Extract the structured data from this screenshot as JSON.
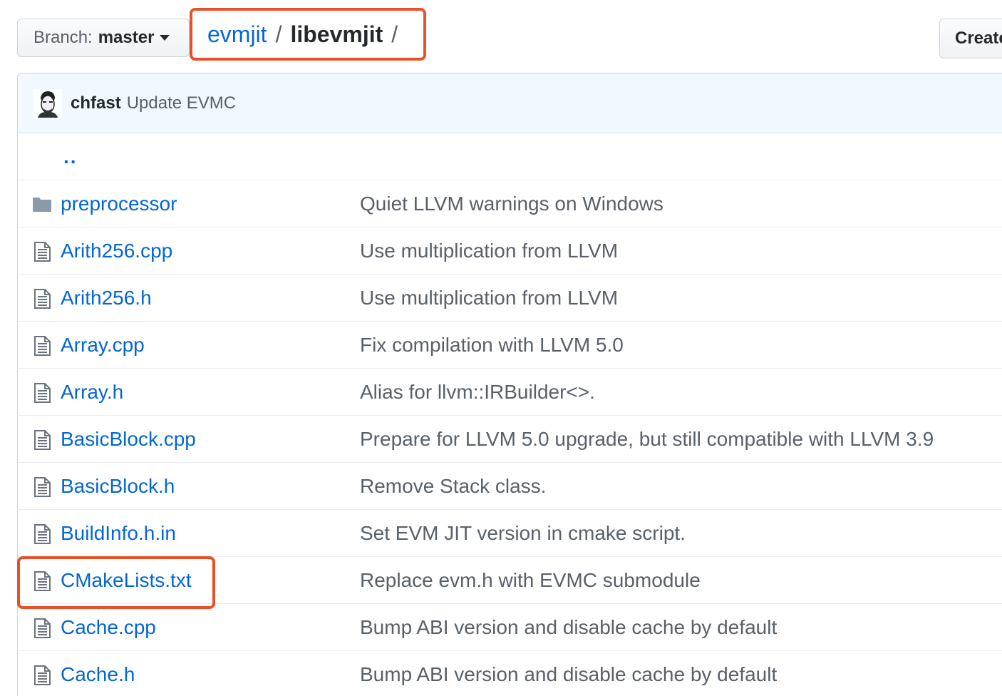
{
  "branch": {
    "prefix": "Branch:",
    "name": "master"
  },
  "breadcrumb": {
    "repo": "evmjit",
    "separator": "/",
    "current": "libevmjit",
    "trailing": "/"
  },
  "create_button": {
    "label": "Create"
  },
  "commit": {
    "author": "chfast",
    "message": "Update EVMC"
  },
  "up_dir": {
    "label": ".."
  },
  "files": [
    {
      "name": "preprocessor",
      "type": "folder",
      "message": "Quiet LLVM warnings on Windows"
    },
    {
      "name": "Arith256.cpp",
      "type": "file",
      "message": "Use multiplication from LLVM"
    },
    {
      "name": "Arith256.h",
      "type": "file",
      "message": "Use multiplication from LLVM"
    },
    {
      "name": "Array.cpp",
      "type": "file",
      "message": "Fix compilation with LLVM 5.0"
    },
    {
      "name": "Array.h",
      "type": "file",
      "message": "Alias for llvm::IRBuilder<>."
    },
    {
      "name": "BasicBlock.cpp",
      "type": "file",
      "message": "Prepare for LLVM 5.0 upgrade, but still compatible with LLVM 3.9"
    },
    {
      "name": "BasicBlock.h",
      "type": "file",
      "message": "Remove Stack class."
    },
    {
      "name": "BuildInfo.h.in",
      "type": "file",
      "message": "Set EVM JIT version in cmake script."
    },
    {
      "name": "CMakeLists.txt",
      "type": "file",
      "message": "Replace evm.h with EVMC submodule"
    },
    {
      "name": "Cache.cpp",
      "type": "file",
      "message": "Bump ABI version and disable cache by default"
    },
    {
      "name": "Cache.h",
      "type": "file",
      "message": "Bump ABI version and disable cache by default"
    }
  ],
  "colors": {
    "link": "#0366d6",
    "highlight": "#e8502a",
    "commit_bg": "#f1f8ff"
  }
}
